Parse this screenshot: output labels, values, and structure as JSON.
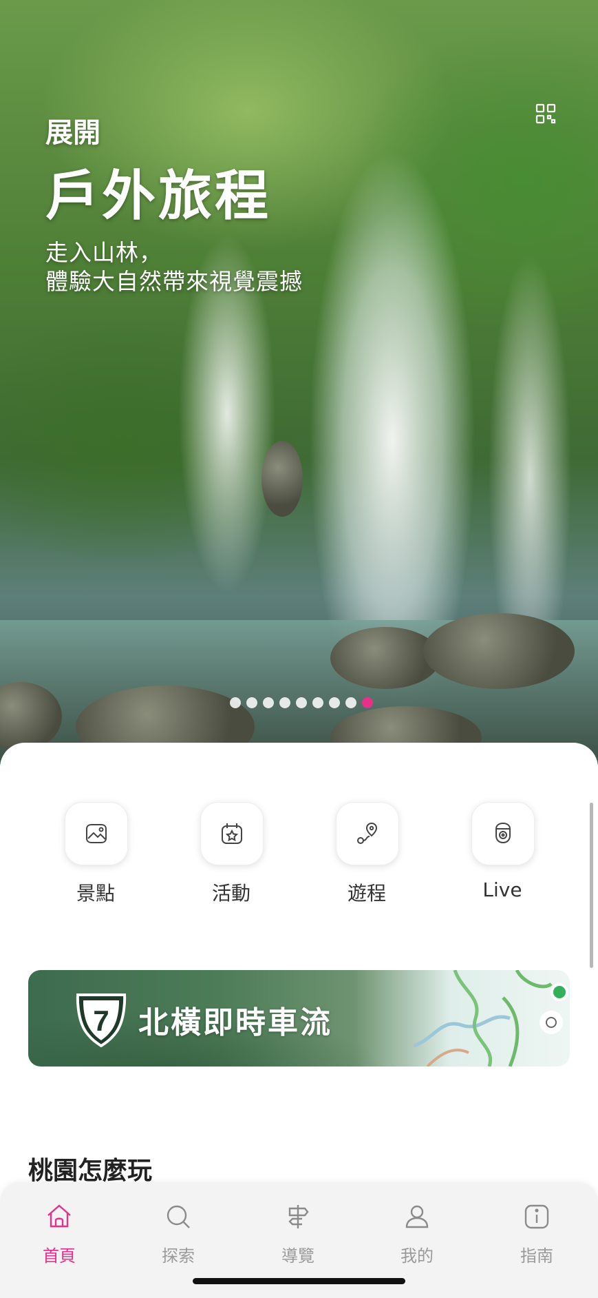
{
  "hero": {
    "subtitle": "展開",
    "title": "戶外旅程",
    "description_line1": "走入山林，",
    "description_line2": "體驗大自然帶來視覺震撼",
    "carousel": {
      "total": 9,
      "active_index": 9
    }
  },
  "quick_actions": [
    {
      "label": "景點",
      "icon": "landscape-icon"
    },
    {
      "label": "活動",
      "icon": "calendar-star-icon"
    },
    {
      "label": "遊程",
      "icon": "route-pin-icon"
    },
    {
      "label": "Live",
      "icon": "camera-icon"
    }
  ],
  "banner": {
    "route_number": "7",
    "title": "北橫即時車流"
  },
  "section": {
    "title": "桃園怎麼玩"
  },
  "tabbar": {
    "items": [
      {
        "label": "首頁",
        "icon": "home-icon",
        "active": true
      },
      {
        "label": "探索",
        "icon": "search-icon",
        "active": false
      },
      {
        "label": "導覽",
        "icon": "signpost-icon",
        "active": false
      },
      {
        "label": "我的",
        "icon": "user-icon",
        "active": false
      },
      {
        "label": "指南",
        "icon": "info-icon",
        "active": false
      }
    ]
  },
  "colors": {
    "accent": "#e6318a",
    "inactive": "#9a9a9a",
    "banner_green": "#3d6b4e"
  }
}
